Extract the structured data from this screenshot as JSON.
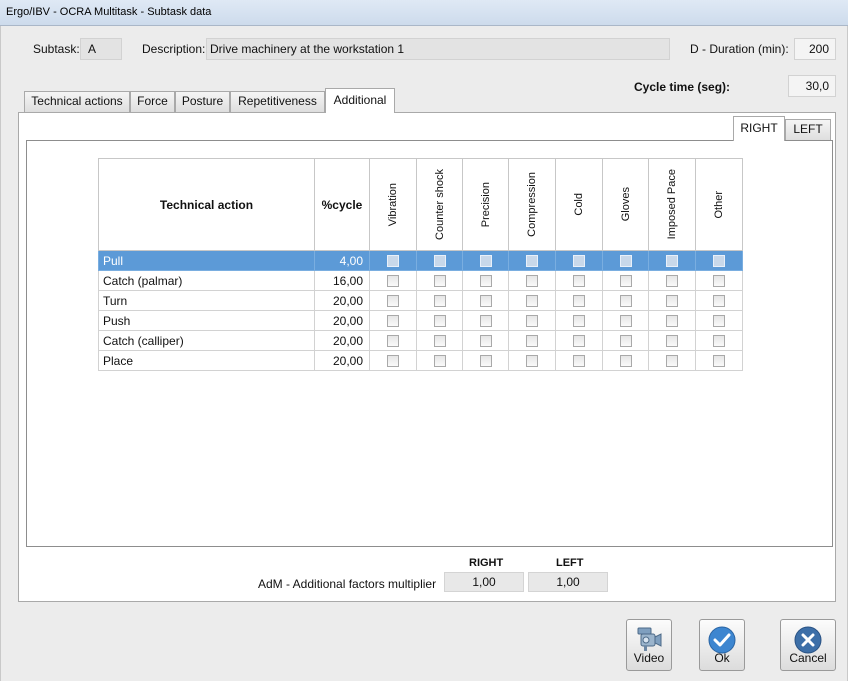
{
  "window": {
    "title": "Ergo/IBV - OCRA Multitask - Subtask data"
  },
  "header": {
    "subtask_label": "Subtask:",
    "subtask_value": "A",
    "description_label": "Description:",
    "description_value": "Drive machinery at the workstation 1",
    "duration_label": "D - Duration (min):",
    "duration_value": "200",
    "cycle_label": "Cycle time (seg):",
    "cycle_value": "30,0"
  },
  "tabs": [
    {
      "label": "Technical actions"
    },
    {
      "label": "Force"
    },
    {
      "label": "Posture"
    },
    {
      "label": "Repetitiveness"
    },
    {
      "label": "Additional",
      "active": true
    }
  ],
  "side_tabs": [
    {
      "label": "RIGHT",
      "active": true
    },
    {
      "label": "LEFT"
    }
  ],
  "table": {
    "headers": {
      "action": "Technical action",
      "cycle": "%cycle",
      "factors": [
        "Vibration",
        "Counter shock",
        "Precision",
        "Compression",
        "Cold",
        "Gloves",
        "Imposed Pace",
        "Other"
      ]
    },
    "rows": [
      {
        "action": "Pull",
        "cycle": "4,00",
        "selected": true
      },
      {
        "action": "Catch (palmar)",
        "cycle": "16,00"
      },
      {
        "action": "Turn",
        "cycle": "20,00"
      },
      {
        "action": "Push",
        "cycle": "20,00"
      },
      {
        "action": "Catch (calliper)",
        "cycle": "20,00"
      },
      {
        "action": "Place",
        "cycle": "20,00"
      }
    ]
  },
  "multiplier": {
    "label": "AdM - Additional factors multiplier",
    "right_header": "RIGHT",
    "left_header": "LEFT",
    "right_value": "1,00",
    "left_value": "1,00"
  },
  "buttons": {
    "video": "Video",
    "ok": "Ok",
    "cancel": "Cancel"
  },
  "icons": {
    "video": "video-camera-icon",
    "ok": "checkmark-icon",
    "cancel": "close-icon"
  },
  "colors": {
    "selected_row": "#5c9ad7",
    "ok_icon": "#3d86d0",
    "cancel_icon": "#3d6fa8"
  }
}
